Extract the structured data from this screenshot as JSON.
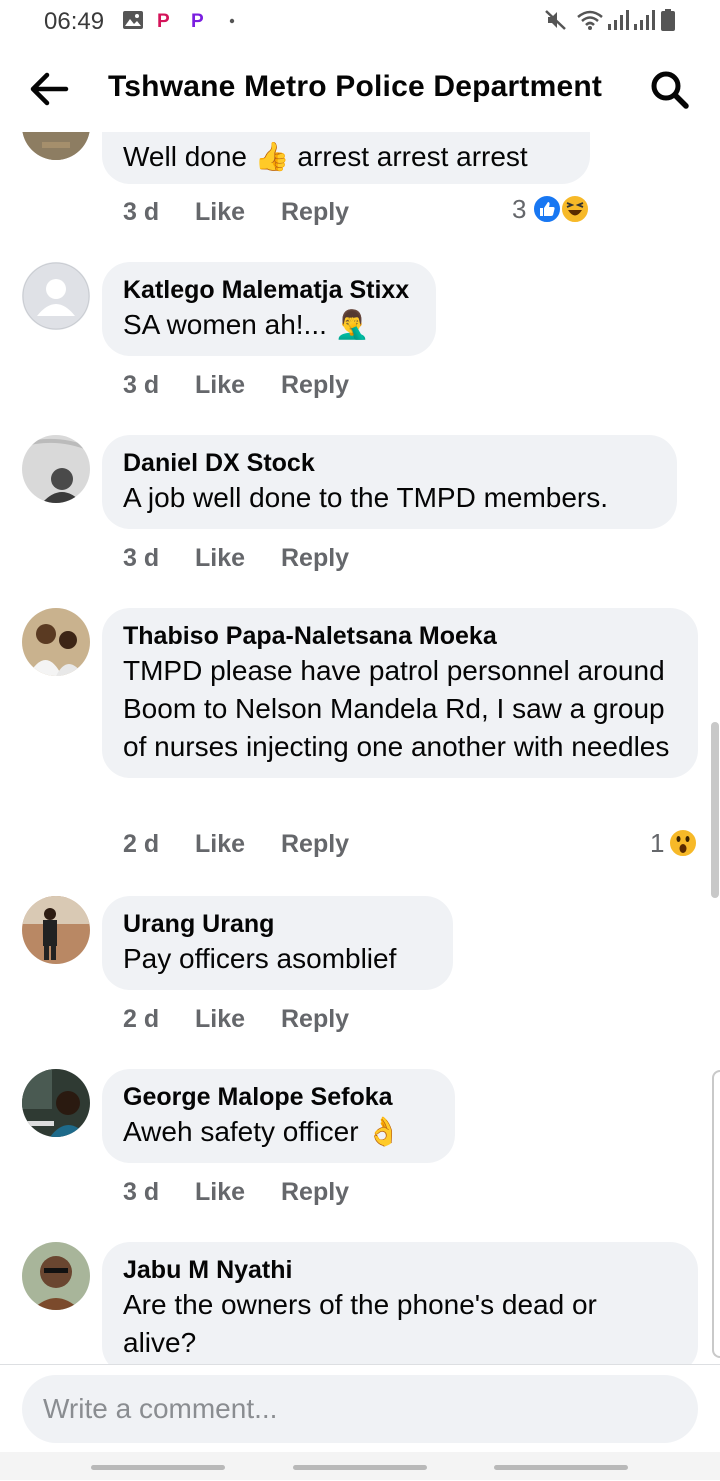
{
  "status_bar": {
    "time": "06:49"
  },
  "header": {
    "title": "Tshwane Metro Police Department"
  },
  "comments": [
    {
      "author": "",
      "text": "Well done 👍 arrest arrest arrest",
      "age": "3 d",
      "like": "Like",
      "reply": "Reply",
      "reaction_count": "3"
    },
    {
      "author": "Katlego Malematja Stixx",
      "text": "SA women ah!... 🤦‍♂️",
      "age": "3 d",
      "like": "Like",
      "reply": "Reply"
    },
    {
      "author": "Daniel DX Stock",
      "text": "A job well done to the TMPD members.",
      "age": "3 d",
      "like": "Like",
      "reply": "Reply"
    },
    {
      "author": "Thabiso Papa-Naletsana Moeka",
      "text": "TMPD please have patrol personnel around Boom to Nelson Mandela Rd, I saw a group of nurses injecting one another with needles",
      "age": "2 d",
      "like": "Like",
      "reply": "Reply",
      "reaction_count": "1"
    },
    {
      "author": "Urang Urang",
      "text": "Pay officers asomblief",
      "age": "2 d",
      "like": "Like",
      "reply": "Reply"
    },
    {
      "author": "George Malope Sefoka",
      "text": "Aweh safety officer 👌",
      "age": "3 d",
      "like": "Like",
      "reply": "Reply"
    },
    {
      "author": "Jabu M Nyathi",
      "text": "Are the owners of the phone's dead or alive?",
      "age": "",
      "like": "",
      "reply": ""
    }
  ],
  "composer": {
    "placeholder": "Write a comment..."
  },
  "colors": {
    "bubble": "#f0f2f5",
    "meta": "#65676b",
    "like_blue": "#1877f2",
    "haha_yellow": "#f7b928"
  }
}
